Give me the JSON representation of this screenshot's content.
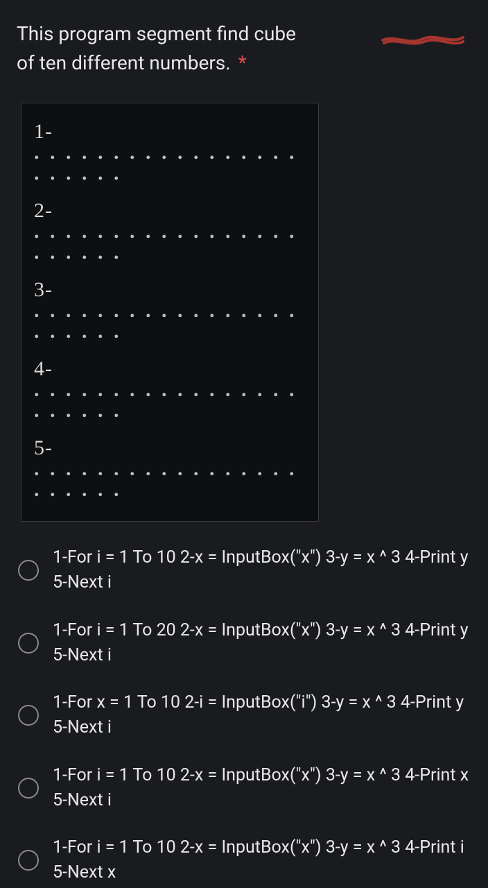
{
  "question": {
    "text_line1": "This program segment find cube",
    "text_line2": "of ten different numbers.",
    "required_marker": "*"
  },
  "codebox": {
    "rows": [
      "1-",
      "2-",
      "3-",
      "4-",
      "5-"
    ],
    "dots": ". . . . . . . . . . . . . . . . . . . . . . ."
  },
  "options": [
    {
      "text": "1-For i = 1 To 10 2-x = InputBox(\"x\") 3-y = x ^ 3 4-Print y 5-Next i"
    },
    {
      "text": "1-For i = 1 To 20 2-x = InputBox(\"x\") 3-y = x ^ 3 4-Print y 5-Next i"
    },
    {
      "text": "1-For x = 1 To 10 2-i = InputBox(\"i\") 3-y = x ^ 3 4-Print y 5-Next i"
    },
    {
      "text": "1-For i = 1 To 10 2-x = InputBox(\"x\") 3-y = x ^ 3 4-Print x 5-Next i"
    },
    {
      "text": "1-For i = 1 To 10 2-x = InputBox(\"x\") 3-y = x ^ 3 4-Print i 5-Next x"
    }
  ]
}
